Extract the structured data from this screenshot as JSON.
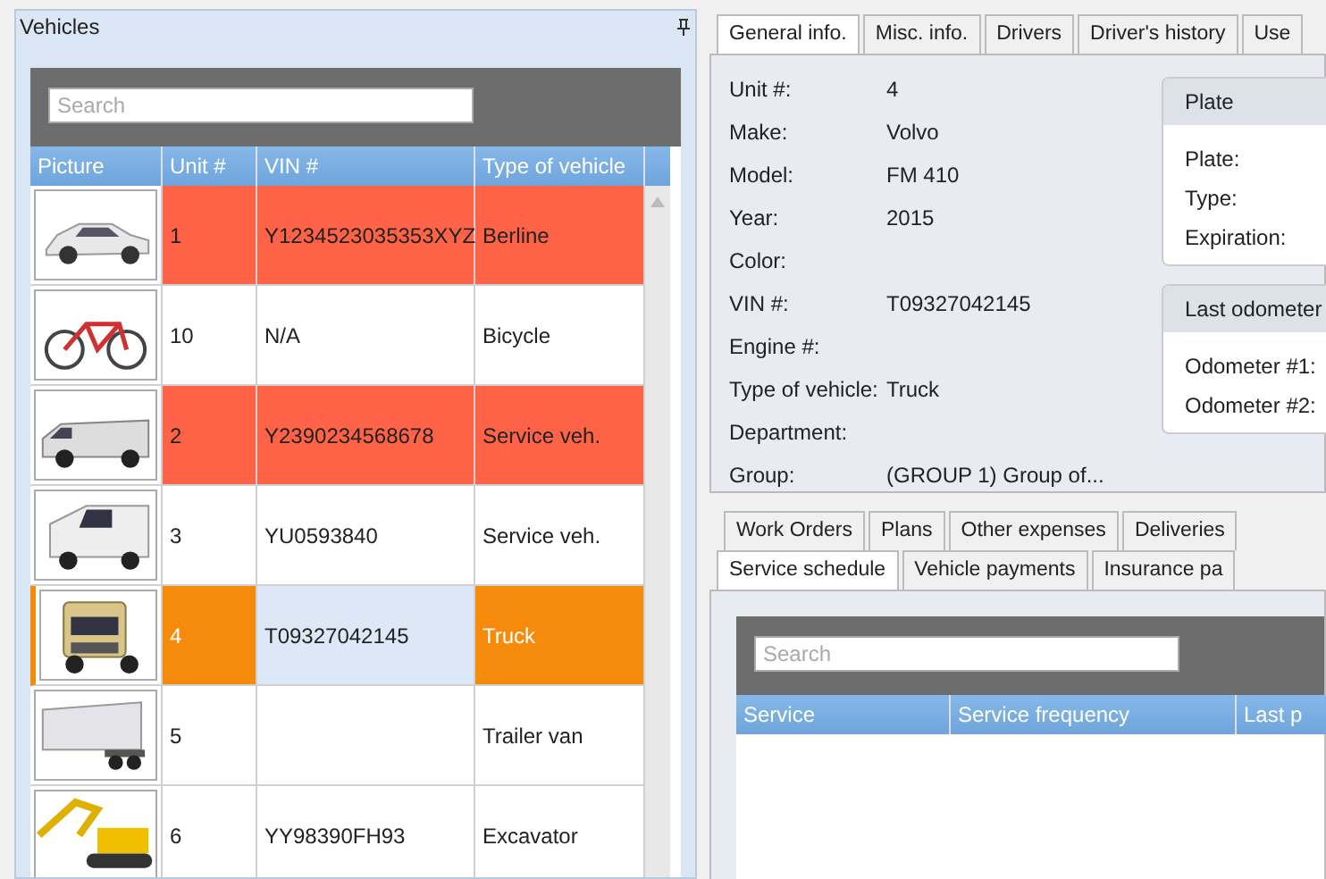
{
  "vehicles_panel": {
    "title": "Vehicles",
    "search": {
      "placeholder": "Search"
    },
    "columns": [
      "Picture",
      "Unit #",
      "VIN #",
      "Type of vehicle"
    ],
    "rows": [
      {
        "unit": "1",
        "vin": "Y1234523035353XYZ",
        "type": "Berline",
        "color": "#ff6347",
        "selected": false
      },
      {
        "unit": "10",
        "vin": "N/A",
        "type": "Bicycle",
        "selected": false
      },
      {
        "unit": "2",
        "vin": "Y2390234568678",
        "type": "Service veh.",
        "color": "#ff6347",
        "selected": false
      },
      {
        "unit": "3",
        "vin": "YU0593840",
        "type": "Service veh.",
        "selected": false
      },
      {
        "unit": "4",
        "vin": "T09327042145",
        "type": "Truck",
        "color": "#f68b0b",
        "selected": true
      },
      {
        "unit": "5",
        "type": "Trailer van",
        "selected": false
      },
      {
        "unit": "6",
        "vin": "YY98390FH93",
        "type": "Excavator",
        "selected": false
      }
    ]
  },
  "tabs": [
    {
      "label": "General info.",
      "selected": true
    },
    {
      "label": "Misc. info.",
      "selected": false
    },
    {
      "label": "Drivers",
      "selected": false
    },
    {
      "label": "Driver's history",
      "selected": false
    },
    {
      "label": "Use",
      "selected": false
    }
  ],
  "fields": [
    {
      "label": "Unit #:",
      "value": "4"
    },
    {
      "label": "Make:",
      "value": "Volvo"
    },
    {
      "label": "Model:",
      "value": "FM 410"
    },
    {
      "label": "Year:",
      "value": "2015"
    },
    {
      "label": "Color:"
    },
    {
      "label": "VIN #:",
      "value": "T09327042145"
    },
    {
      "label": "Engine #:"
    },
    {
      "label": "Type of vehicle:",
      "value": "Truck"
    },
    {
      "label": "Department:"
    },
    {
      "label": "Group:",
      "value": "(GROUP 1) Group of..."
    }
  ],
  "plate": {
    "title": "Plate",
    "fields": [
      "Plate:",
      "Type:",
      "Expiration:"
    ]
  },
  "odometer": {
    "title": "Last odometer",
    "fields": [
      "Odometer #1:",
      "Odometer #2:"
    ]
  },
  "detail_tabs": [
    [
      {
        "label": "Work Orders",
        "selected": false
      },
      {
        "label": "Plans",
        "selected": false
      },
      {
        "label": "Other expenses",
        "selected": false
      },
      {
        "label": "Deliveries",
        "selected": false
      }
    ],
    [
      {
        "label": "Service schedule",
        "selected": true
      },
      {
        "label": "Vehicle payments",
        "selected": false
      },
      {
        "label": "Insurance pa",
        "selected": false
      }
    ]
  ],
  "service": {
    "search": {
      "placeholder": "Search"
    },
    "columns": [
      "Service",
      "Service frequency",
      "Last p"
    ]
  }
}
